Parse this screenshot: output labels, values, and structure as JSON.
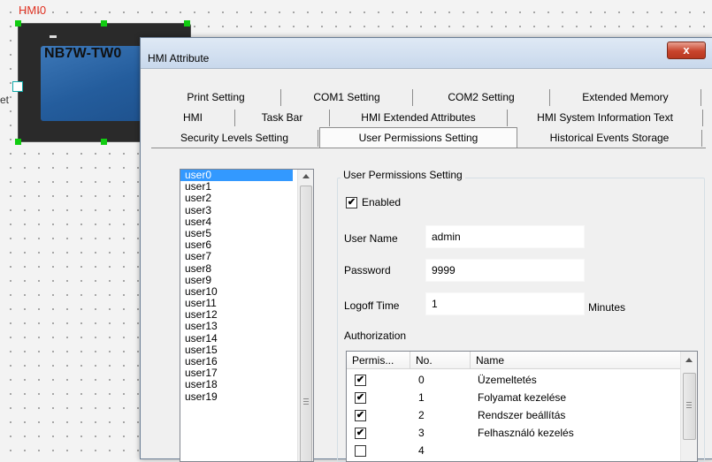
{
  "canvas": {
    "object_label": "HMI0",
    "device_model": "NB7W-TW0",
    "side_label": "et"
  },
  "dialog": {
    "title": "HMI Attribute",
    "close_glyph": "x",
    "tabs_row1": [
      "Print Setting",
      "COM1 Setting",
      "COM2 Setting",
      "Extended Memory"
    ],
    "tabs_row2": [
      "HMI",
      "Task Bar",
      "HMI Extended Attributes",
      "HMI System Information Text"
    ],
    "tabs_row3": [
      "Security Levels Setting",
      "User Permissions Setting",
      "Historical Events Storage"
    ],
    "selected_tab": "User Permissions Setting"
  },
  "users": {
    "items": [
      "user0",
      "user1",
      "user2",
      "user3",
      "user4",
      "user5",
      "user6",
      "user7",
      "user8",
      "user9",
      "user10",
      "user11",
      "user12",
      "user13",
      "user14",
      "user15",
      "user16",
      "user17",
      "user18",
      "user19"
    ],
    "selected": "user0"
  },
  "permissions": {
    "group_title": "User Permissions Setting",
    "enabled_label": "Enabled",
    "enabled": true,
    "user_name_label": "User Name",
    "user_name_value": "admin",
    "password_label": "Password",
    "password_value": "9999",
    "logoff_label": "Logoff Time",
    "logoff_value": "1",
    "logoff_unit": "Minutes",
    "authorization_label": "Authorization",
    "table": {
      "headers": [
        "Permis...",
        "No.",
        "Name"
      ],
      "rows": [
        {
          "checked": true,
          "no": "0",
          "name": "Üzemeltetés"
        },
        {
          "checked": true,
          "no": "1",
          "name": "Folyamat kezelése"
        },
        {
          "checked": true,
          "no": "2",
          "name": "Rendszer beállítás"
        },
        {
          "checked": true,
          "no": "3",
          "name": "Felhasználó kezelés"
        },
        {
          "checked": false,
          "no": "4",
          "name": ""
        }
      ]
    }
  },
  "colors": {
    "selection": "#3399ff",
    "object_label": "#e03020",
    "handle": "#11cc11",
    "close_button": "#c8442c"
  }
}
